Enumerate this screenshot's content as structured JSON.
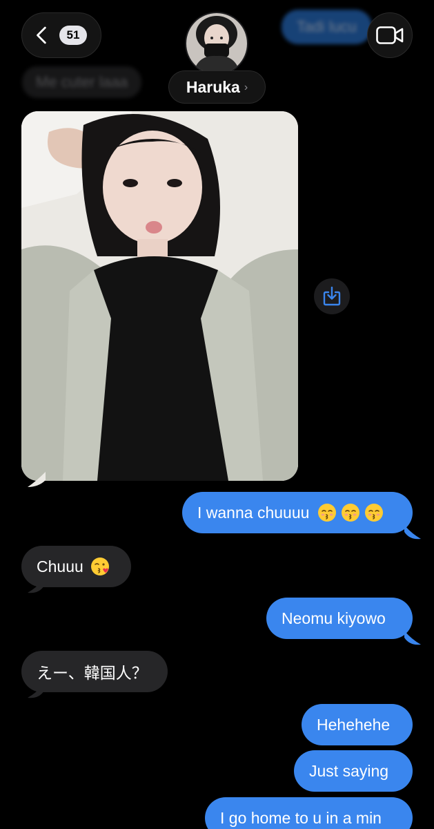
{
  "header": {
    "unread_count": "51",
    "contact_name": "Haruka",
    "name_chevron": "›",
    "back_icon": "chevron-left-icon",
    "video_icon": "video-camera-icon"
  },
  "background_messages": {
    "outgoing_top": "Tadi lucu",
    "incoming_top": "Me cuter laaa"
  },
  "messages": [
    {
      "direction": "incoming",
      "type": "photo"
    },
    {
      "direction": "outgoing",
      "text": "I wanna chuuuu",
      "emoji": "kissing-face-closed-eyes x3"
    },
    {
      "direction": "incoming",
      "text": "Chuuu",
      "emoji": "face-blowing-kiss"
    },
    {
      "direction": "outgoing",
      "text": "Neomu kiyowo"
    },
    {
      "direction": "incoming",
      "text": "えー、韓国人？"
    },
    {
      "direction": "outgoing",
      "text": "Hehehehe"
    },
    {
      "direction": "outgoing",
      "text": "Just saying"
    },
    {
      "direction": "outgoing",
      "text": "I go home to u in a min"
    }
  ],
  "colors": {
    "background": "#000000",
    "outgoing_bubble": "#3a86ee",
    "incoming_bubble": "#262628",
    "accent": "#3a86ee"
  }
}
